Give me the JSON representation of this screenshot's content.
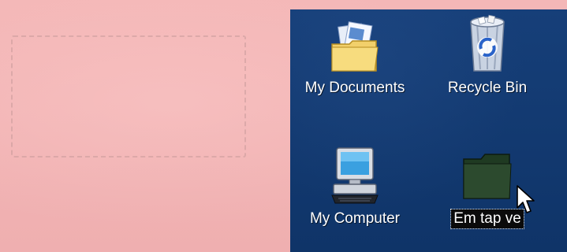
{
  "desktop": {
    "icons": [
      {
        "label": "My Documents",
        "icon": "my-documents-icon"
      },
      {
        "label": "Recycle Bin",
        "icon": "recycle-bin-icon"
      },
      {
        "label": "My Computer",
        "icon": "my-computer-icon"
      },
      {
        "label": "Em tap ve",
        "icon": "folder-icon",
        "selected": true
      }
    ],
    "background_color": "#123a73",
    "selection_color": "#0b0b0b"
  },
  "page": {
    "background_color": "#f2b3b4"
  },
  "pointer": {
    "icon": "mouse-pointer-icon"
  }
}
